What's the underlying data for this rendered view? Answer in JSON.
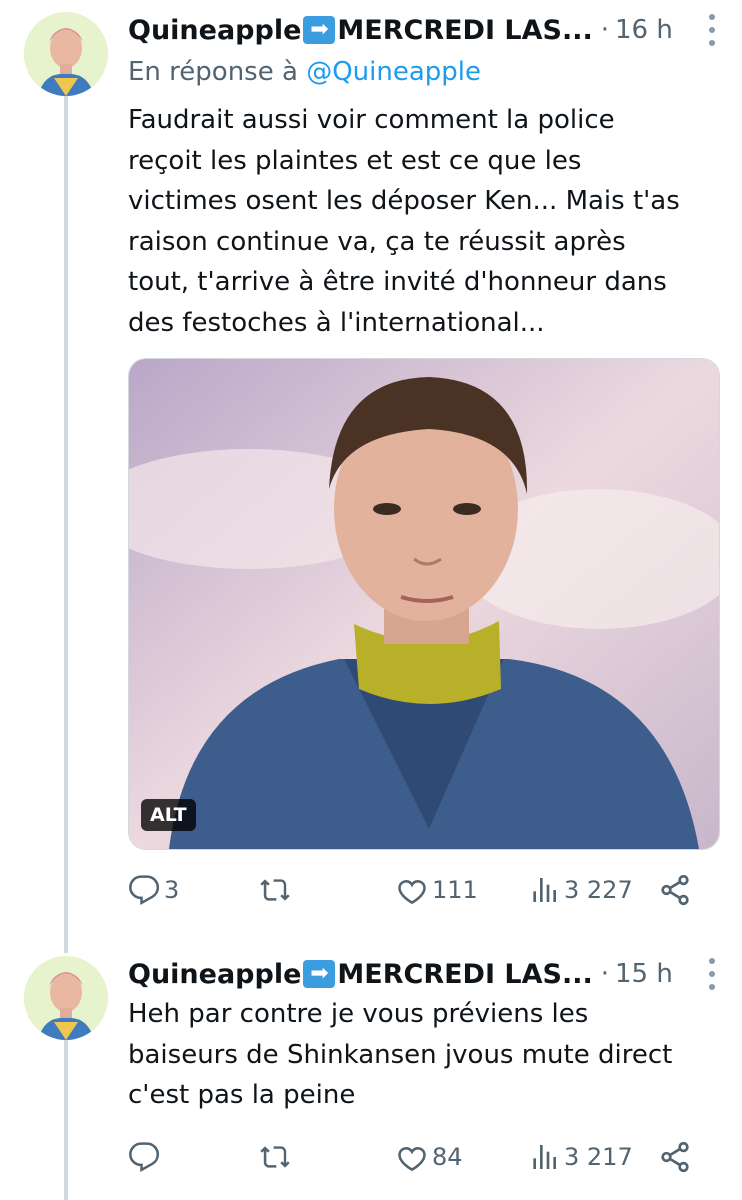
{
  "colors": {
    "accent": "#1d9bf0",
    "secondary_text": "#536471",
    "thread_line": "#cfd9de"
  },
  "tweets": [
    {
      "author": "Quineapple",
      "author_suffix": "MERCREDI LAS...",
      "separator": "·",
      "time": "16 h",
      "reply_prefix": "En réponse à",
      "reply_handle": "@Quineapple",
      "lines": [
        "Faudrait aussi voir comment la police",
        "reçoit les plaintes et est ce que les",
        "victimes osent les déposer Ken... Mais t'as",
        "raison continue va, ça te réussit après",
        "tout, t'arrive à être invité d'honneur dans",
        "des festoches à l'international..."
      ],
      "media_alt_badge": "ALT",
      "replies": "3",
      "reposts": "",
      "likes": "111",
      "views": "3 227"
    },
    {
      "author": "Quineapple",
      "author_suffix": "MERCREDI LAS...",
      "separator": "·",
      "time": "15 h",
      "lines": [
        "Heh par contre je vous préviens les",
        "baiseurs de Shinkansen jvous mute direct",
        "c'est pas la peine"
      ],
      "replies": "",
      "reposts": "",
      "likes": "84",
      "views": "3 217"
    }
  ],
  "icons": {
    "reply": "reply-bubble-icon",
    "repost": "repost-arrows-icon",
    "like": "heart-icon",
    "views": "views-bars-icon",
    "share": "share-icon",
    "more": "more-vertical-icon",
    "emoji": "right-arrow-emoji"
  }
}
